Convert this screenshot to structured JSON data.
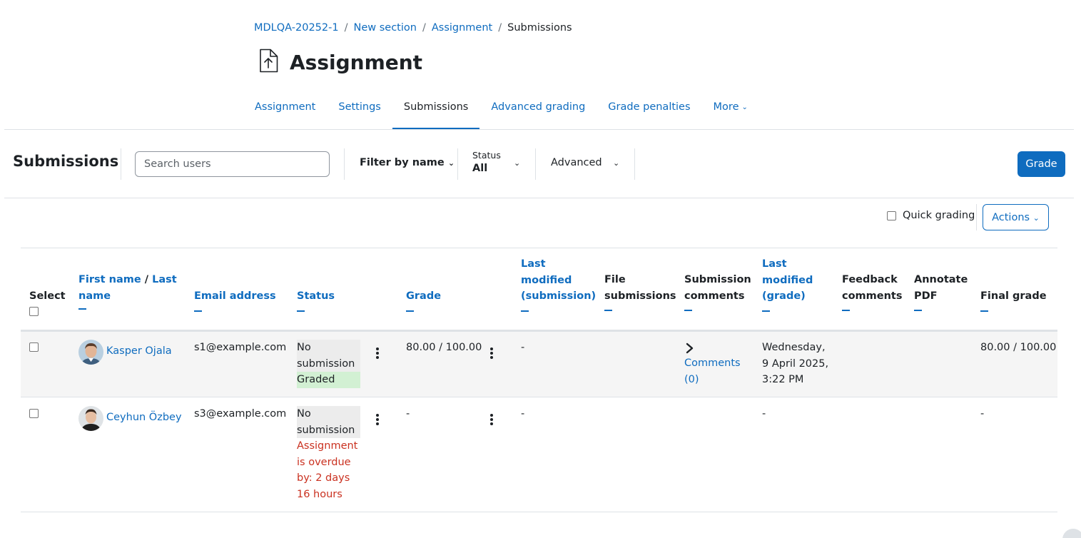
{
  "breadcrumb": [
    "MDLQA-20252-1",
    "New section",
    "Assignment",
    "Submissions"
  ],
  "page": {
    "title": "Assignment"
  },
  "tabs": [
    {
      "label": "Assignment"
    },
    {
      "label": "Settings"
    },
    {
      "label": "Submissions",
      "active": true
    },
    {
      "label": "Advanced grading"
    },
    {
      "label": "Grade penalties"
    },
    {
      "label": "More"
    }
  ],
  "toolbar": {
    "title": "Submissions",
    "search_placeholder": "Search users",
    "filter_name": "Filter by name",
    "status_label": "Status",
    "status_value": "All",
    "advanced": "Advanced",
    "grade_button": "Grade"
  },
  "controls": {
    "quick_grading": "Quick grading",
    "actions": "Actions"
  },
  "table": {
    "headers": {
      "select": "Select",
      "first_name": "First name",
      "slash": "/",
      "last_name": "Last name",
      "email": "Email address",
      "status": "Status",
      "grade": "Grade",
      "last_modified_submission": "Last modified (submission)",
      "file_submissions": "File submissions",
      "submission_comments": "Submission comments",
      "last_modified_grade": "Last modified (grade)",
      "feedback_comments": "Feedback comments",
      "annotate_pdf": "Annotate PDF",
      "final_grade": "Final grade"
    },
    "rows": [
      {
        "name": "Kasper Ojala",
        "email": "s1@example.com",
        "status": "No submission",
        "status_extra": "Graded",
        "grade": "80.00 / 100.00",
        "last_modified_submission": "-",
        "comments": "Comments (0)",
        "last_modified_grade": "Wednesday, 9 April 2025, 3:22 PM",
        "final_grade": "80.00 / 100.00"
      },
      {
        "name": "Ceyhun Özbey",
        "email": "s3@example.com",
        "status": "No submission",
        "status_extra": "Assignment is overdue by: 2 days 16 hours",
        "grade": "-",
        "last_modified_submission": "-",
        "last_modified_grade": "-",
        "final_grade": "-"
      }
    ]
  },
  "colors": {
    "accent": "#0f6cbf",
    "graded_bg": "#d2f0d3",
    "overdue": "#ca3120"
  }
}
